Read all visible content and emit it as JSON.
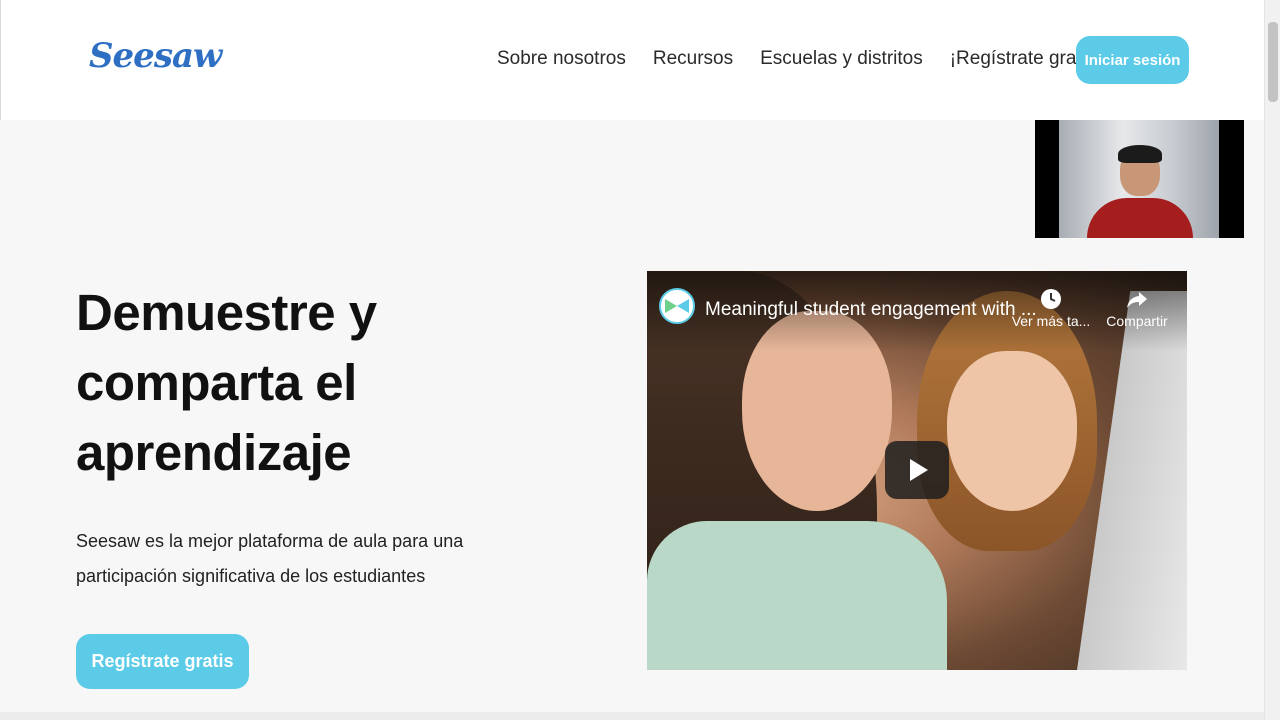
{
  "header": {
    "logo_text": "Seesaw",
    "nav": [
      {
        "label": "Sobre nosotros"
      },
      {
        "label": "Recursos"
      },
      {
        "label": "Escuelas y distritos"
      },
      {
        "label": "¡Regístrate gratis!"
      }
    ],
    "login_label": "Iniciar sesión"
  },
  "hero": {
    "title": "Demuestre y comparta el aprendizaje",
    "subtitle": "Seesaw es la mejor plataforma de aula para una participación significativa de los estudiantes",
    "cta_label": "Regístrate gratis"
  },
  "video": {
    "title": "Meaningful student engagement with ...",
    "watch_later_label": "Ver más ta...",
    "share_label": "Compartir",
    "watch_later_icon": "clock-icon",
    "share_icon": "share-arrow-icon",
    "play_icon": "play-icon"
  },
  "colors": {
    "accent": "#5bcbe8",
    "logo": "#2e6fc4",
    "background": "#f7f7f8"
  }
}
